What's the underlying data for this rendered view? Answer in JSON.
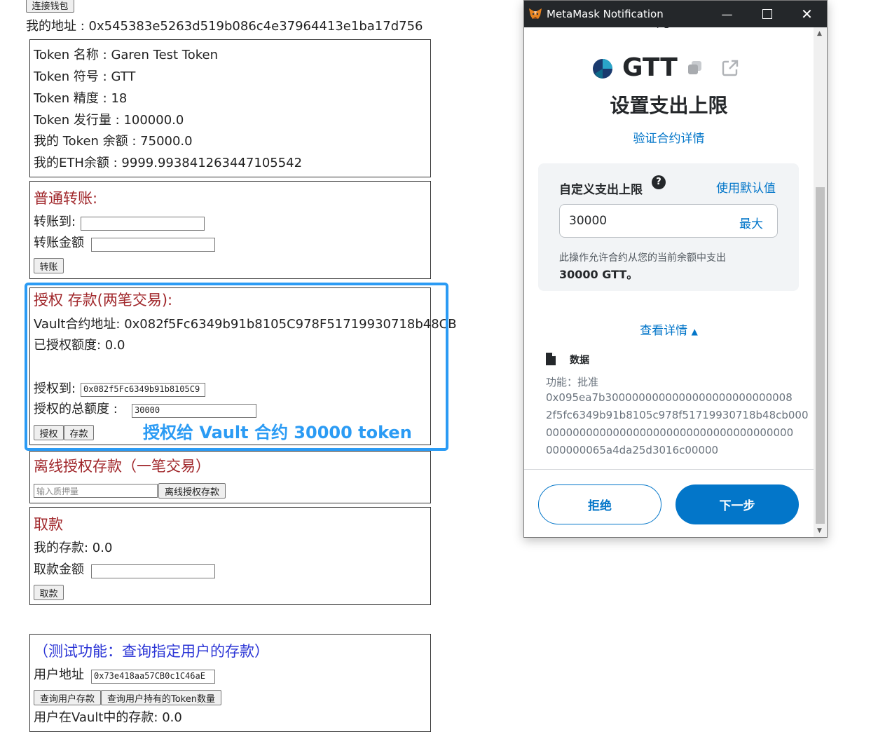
{
  "dapp": {
    "connect_wallet_label": "连接钱包",
    "my_address": "我的地址 : 0x545383e5263d519b086c4e37964413e1ba17d756",
    "token_info": {
      "name": "Token 名称 : Garen Test Token",
      "symbol": "Token 符号 : GTT",
      "decimals": "Token 精度 : 18",
      "supply": "Token 发行量 : 100000.0",
      "my_balance": "我的 Token 余额 : 75000.0",
      "eth_balance": "我的ETH余额 : 9999.993841263447105542"
    },
    "transfer": {
      "title": "普通转账:",
      "to_label": "转账到:",
      "amount_label": "转账金额",
      "button": "转账"
    },
    "approve": {
      "title": "授权 存款(两笔交易):",
      "vault_address": "Vault合约地址: 0x082f5Fc6349b91b8105C978F51719930718b48CB",
      "allowance": "已授权额度: 0.0",
      "to_label": "授权到:",
      "to_value": "0x082f5Fc6349b91b8105C9",
      "amount_label": "授权的总额度 :",
      "amount_value": "30000",
      "approve_button": "授权",
      "deposit_button": "存款",
      "annotation": "授权给 Vault 合约 30000 token",
      "highlight_color": "#2b9bf4"
    },
    "permit": {
      "title": "离线授权存款（一笔交易）",
      "placeholder": "输入质押量",
      "button": "离线授权存款"
    },
    "withdraw": {
      "title": "取款",
      "my_deposit": "我的存款: 0.0",
      "amount_label": "取款金额",
      "button": "取款"
    },
    "query": {
      "title": "（测试功能：查询指定用户的存款）",
      "user_label": "用户地址",
      "user_value": "0x73e418aa57CB0c1C46aE",
      "query_deposit_button": "查询用户存款",
      "query_token_button": "查询用户持有的Token数量",
      "result": "用户在Vault中的存款: 0.0"
    }
  },
  "metamask": {
    "window_title": "MetaMask Notification",
    "top_partial_text": "为",
    "token_symbol": "GTT",
    "heading": "设置支出上限",
    "verify_link": "验证合约详情",
    "custom_limit_label": "自定义支出上限",
    "help_icon": "?",
    "use_default_link": "使用默认值",
    "limit_value": "30000",
    "max_link": "最大",
    "description_line1": "此操作允许合约从您的当前余额中支出",
    "description_line2": "30000 GTT。",
    "view_details": "查看详情",
    "data_title": "数据",
    "function_label": "功能：批准",
    "hex_lines": [
      "0x095ea7b3000000000000000000000000008",
      "2f5fc6349b91b8105c978f51719930718b48cb000",
      "0000000000000000000000000000000000000",
      "000000065a4da25d3016c00000"
    ],
    "reject_button": "拒绝",
    "next_button": "下一步",
    "accent_color": "#0376c9"
  }
}
